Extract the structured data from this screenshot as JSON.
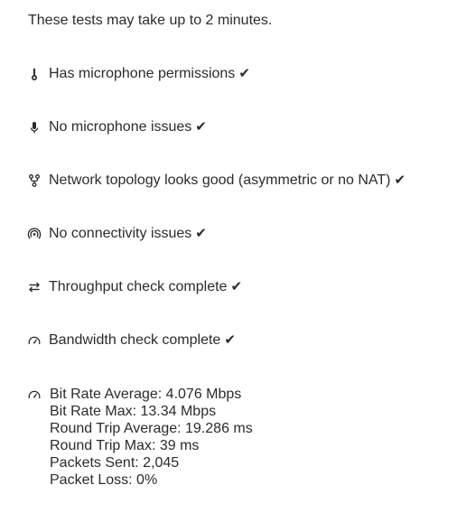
{
  "intro": "These tests may take up to 2 minutes.",
  "check_mark": "✔",
  "checks": [
    {
      "icon": "thermometer-icon",
      "label": "Has microphone permissions",
      "status": "passed"
    },
    {
      "icon": "microphone-icon",
      "label": "No microphone issues",
      "status": "passed"
    },
    {
      "icon": "network-topology-icon",
      "label": "Network topology looks good (asymmetric or no NAT)",
      "status": "passed"
    },
    {
      "icon": "connectivity-icon",
      "label": "No connectivity issues",
      "status": "passed"
    },
    {
      "icon": "swap-arrows-icon",
      "label": "Throughput check complete",
      "status": "passed"
    },
    {
      "icon": "speedometer-icon",
      "label": "Bandwidth check complete",
      "status": "passed"
    }
  ],
  "stats": {
    "icon": "speedometer-icon",
    "lines": [
      "Bit Rate Average: 4.076 Mbps",
      "Bit Rate Max: 13.34 Mbps",
      "Round Trip Average: 19.286 ms",
      "Round Trip Max: 39 ms",
      "Packets Sent: 2,045",
      "Packet Loss: 0%"
    ]
  },
  "colors": {
    "text": "#2b2b2b",
    "background": "#ffffff"
  }
}
